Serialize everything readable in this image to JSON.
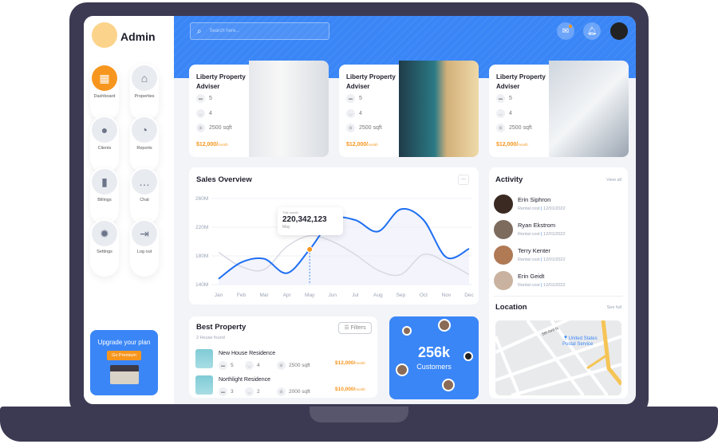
{
  "sidebar": {
    "brand": "Admin",
    "items": [
      {
        "label": "Dashboard",
        "icon": "grid-icon",
        "active": true
      },
      {
        "label": "Properties",
        "icon": "home-icon"
      },
      {
        "label": "Clients",
        "icon": "user-icon"
      },
      {
        "label": "Reports",
        "icon": "pie-chart-icon"
      },
      {
        "label": "Billings",
        "icon": "wallet-icon"
      },
      {
        "label": "Chat",
        "icon": "chat-icon"
      },
      {
        "label": "Settings",
        "icon": "gear-icon"
      },
      {
        "label": "Log out",
        "icon": "logout-icon"
      }
    ],
    "upgrade": {
      "title": "Upgrade your plan",
      "button": "Go Premium"
    }
  },
  "header": {
    "search_placeholder": "Search here..."
  },
  "properties": [
    {
      "title": "Liberty Property Adviser",
      "beds": "5",
      "baths": "4",
      "area": "2500 sqft",
      "price": "$12,000/",
      "unit": "month"
    },
    {
      "title": "Liberty Property Adviser",
      "beds": "5",
      "baths": "4",
      "area": "2500 sqft",
      "price": "$12,000/",
      "unit": "month"
    },
    {
      "title": "Liberty Property Adviser",
      "beds": "5",
      "baths": "4",
      "area": "2500 sqft",
      "price": "$12,000/",
      "unit": "month"
    }
  ],
  "sales": {
    "title": "Sales Overview",
    "more": "···",
    "tooltip": {
      "label": "This month",
      "value": "220,342,123",
      "month": "May"
    }
  },
  "chart_data": {
    "type": "line",
    "categories": [
      "Jan",
      "Feb",
      "Mar",
      "Apr",
      "May",
      "Jun",
      "Jul",
      "Aug",
      "Sep",
      "Oct",
      "Nov",
      "Dec"
    ],
    "yticks": [
      "260M",
      "220M",
      "180M",
      "140M"
    ],
    "ylim": [
      140,
      260
    ],
    "series": [
      {
        "color": "#1f6ff2",
        "values": [
          148,
          171,
          176,
          156,
          189,
          230,
          230,
          214,
          245,
          230,
          178,
          190
        ]
      },
      {
        "color": "#d8d9e3",
        "values": [
          185,
          165,
          161,
          193,
          208,
          200,
          182,
          160,
          154,
          182,
          171,
          154
        ]
      }
    ],
    "highlight": {
      "category": "May"
    }
  },
  "activity": {
    "title": "Activity",
    "view_all": "View all",
    "items": [
      {
        "name": "Erin Siphron",
        "meta": "Rental cost",
        "date": "12/01/2022"
      },
      {
        "name": "Ryan Ekstrom",
        "meta": "Rental cost",
        "date": "12/01/2022"
      },
      {
        "name": "Terry Kenter",
        "meta": "Rental cost",
        "date": "12/01/2022"
      },
      {
        "name": "Erin Geidt",
        "meta": "Rental cost",
        "date": "12/01/2022"
      }
    ]
  },
  "location": {
    "title": "Location",
    "see_full": "See full",
    "street": "5th Ave N",
    "poi": "United States Postal Service"
  },
  "best": {
    "title": "Best Property",
    "count": "2 House found",
    "filters": "Filters",
    "items": [
      {
        "name": "New House Residence",
        "beds": "5",
        "baths": "4",
        "area": "2500 sqft",
        "price": "$12,000/",
        "unit": "month"
      },
      {
        "name": "Northlight Residence",
        "beds": "3",
        "baths": "2",
        "area": "2000 sqft",
        "price": "$10,000/",
        "unit": "month"
      }
    ]
  },
  "customers": {
    "count": "256k",
    "label": "Customers"
  },
  "colors": {
    "primary": "#3a86f7",
    "accent": "#f7961e"
  }
}
